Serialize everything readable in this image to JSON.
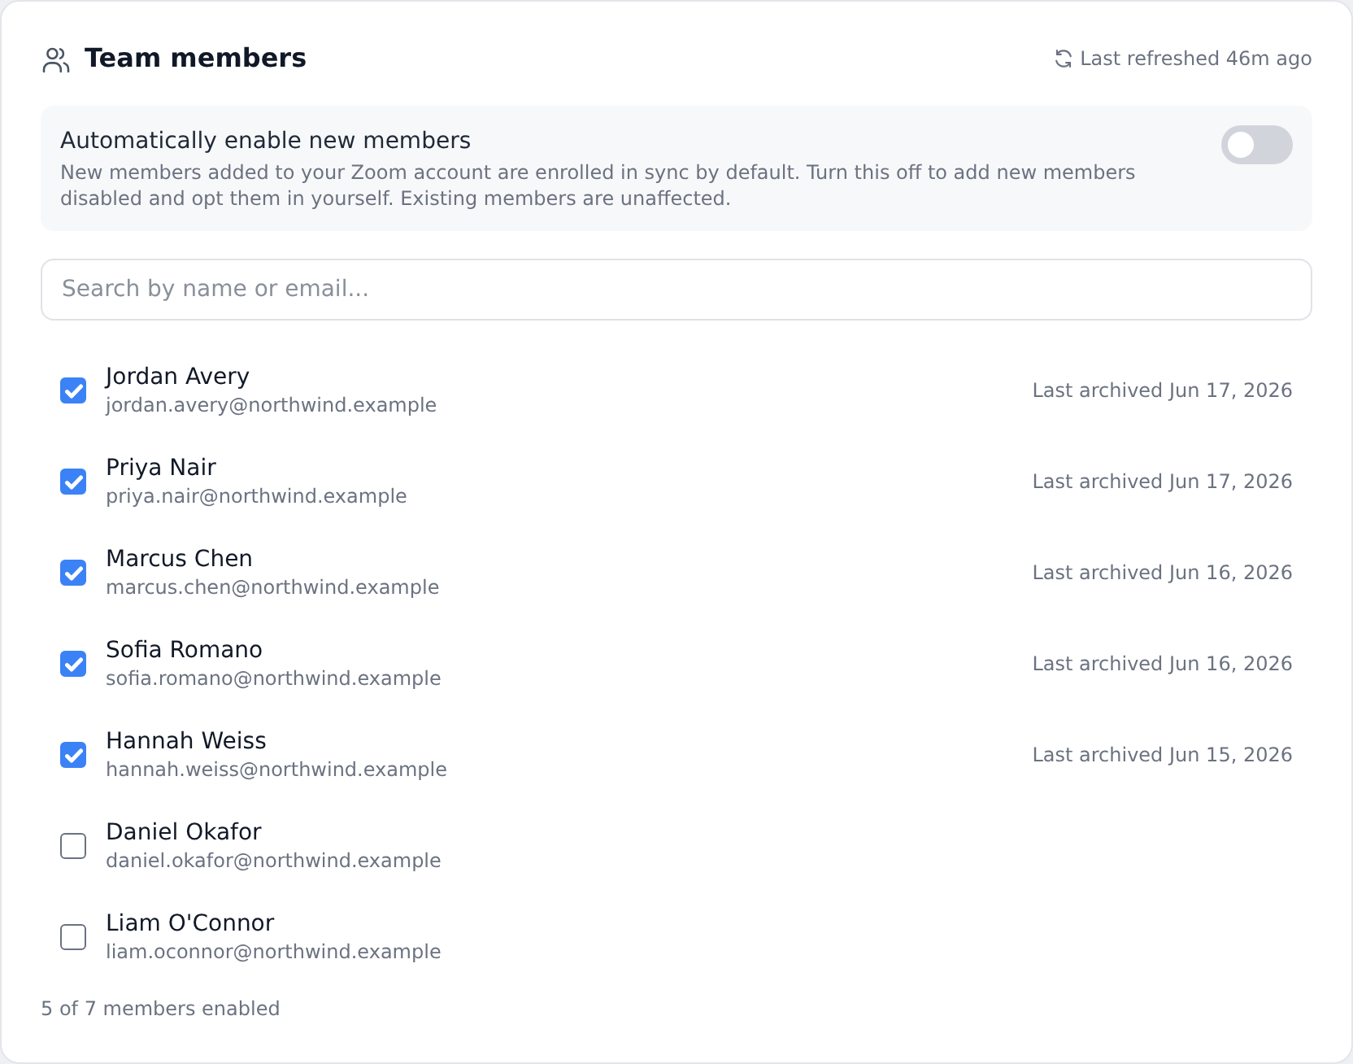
{
  "header": {
    "title": "Team members",
    "refreshed": "Last refreshed 46m ago"
  },
  "auto_enable": {
    "title": "Automatically enable new members",
    "description": "New members added to your Zoom account are enrolled in sync by default. Turn this off to add new members disabled and opt them in yourself. Existing members are unaffected.",
    "on": false
  },
  "search": {
    "placeholder": "Search by name or email..."
  },
  "members": [
    {
      "name": "Jordan Avery",
      "email": "jordan.avery@northwind.example",
      "checked": true,
      "archived": "Last archived Jun 17, 2026"
    },
    {
      "name": "Priya Nair",
      "email": "priya.nair@northwind.example",
      "checked": true,
      "archived": "Last archived Jun 17, 2026"
    },
    {
      "name": "Marcus Chen",
      "email": "marcus.chen@northwind.example",
      "checked": true,
      "archived": "Last archived Jun 16, 2026"
    },
    {
      "name": "Sofia Romano",
      "email": "sofia.romano@northwind.example",
      "checked": true,
      "archived": "Last archived Jun 16, 2026"
    },
    {
      "name": "Hannah Weiss",
      "email": "hannah.weiss@northwind.example",
      "checked": true,
      "archived": "Last archived Jun 15, 2026"
    },
    {
      "name": "Daniel Okafor",
      "email": "daniel.okafor@northwind.example",
      "checked": false
    },
    {
      "name": "Liam O'Connor",
      "email": "liam.oconnor@northwind.example",
      "checked": false
    }
  ],
  "footer": "5 of 7 members enabled"
}
